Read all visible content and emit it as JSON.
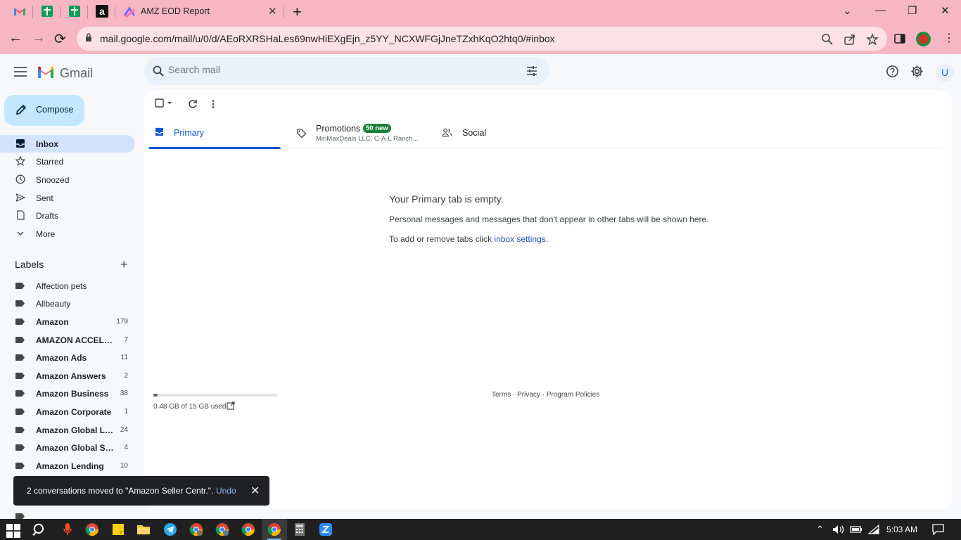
{
  "browser": {
    "active_tab_title": "AMZ EOD Report",
    "url": "mail.google.com/mail/u/0/d/AEoRXRSHaLes69nwHiEXgEjn_z5YY_NCXWFGjJneTZxhKqO2htq0/#inbox",
    "colors": {
      "chrome_pink": "#f7b6c4",
      "omnibox": "#fde1e7"
    }
  },
  "gmail": {
    "product_name": "Gmail",
    "search_placeholder": "Search mail",
    "avatar_initial": "U",
    "compose_label": "Compose",
    "nav": [
      {
        "label": "Inbox",
        "icon": "inbox-icon",
        "active": true
      },
      {
        "label": "Starred",
        "icon": "star-icon"
      },
      {
        "label": "Snoozed",
        "icon": "clock-icon"
      },
      {
        "label": "Sent",
        "icon": "send-icon"
      },
      {
        "label": "Drafts",
        "icon": "draft-icon"
      },
      {
        "label": "More",
        "icon": "chevron-down-icon"
      }
    ],
    "labels_heading": "Labels",
    "labels": [
      {
        "name": "Affection pets",
        "count": ""
      },
      {
        "name": "Allbeauty",
        "count": ""
      },
      {
        "name": "Amazon",
        "count": "179"
      },
      {
        "name": "AMAZON ACCELER...",
        "count": "7"
      },
      {
        "name": "Amazon Ads",
        "count": "11"
      },
      {
        "name": "Amazon Answers",
        "count": "2"
      },
      {
        "name": "Amazon Business",
        "count": "38"
      },
      {
        "name": "Amazon Corporate",
        "count": "1"
      },
      {
        "name": "Amazon Global Lo...",
        "count": "24"
      },
      {
        "name": "Amazon Global Sell...",
        "count": "4"
      },
      {
        "name": "Amazon Lending",
        "count": "10"
      }
    ],
    "inbox_tabs": [
      {
        "label": "Primary",
        "icon": "inbox-icon",
        "active": true
      },
      {
        "label": "Promotions",
        "icon": "tag-icon",
        "badge": "50 new",
        "subtitle": "MinMaxDeals LLC, C-A-L Ranch..."
      },
      {
        "label": "Social",
        "icon": "people-icon"
      }
    ],
    "empty_title": "Your Primary tab is empty.",
    "empty_desc": "Personal messages and messages that don't appear in other tabs will be shown here.",
    "empty_tabs_prefix": "To add or remove tabs click ",
    "empty_tabs_link": "inbox settings",
    "empty_tabs_suffix": ".",
    "storage_text": "0.48 GB of 15 GB used",
    "storage_fraction": 0.032,
    "footer": "Terms · Privacy · Program Policies",
    "snackbar": {
      "message": "2 conversations moved to \"Amazon Seller Centr.\".",
      "undo_label": "Undo"
    },
    "colors": {
      "accent": "#0b57d0",
      "compose_bg": "#c2e7ff",
      "active_nav": "#d3e3fd",
      "badge": "#188038"
    }
  },
  "taskbar": {
    "clock": "5:03 AM"
  }
}
